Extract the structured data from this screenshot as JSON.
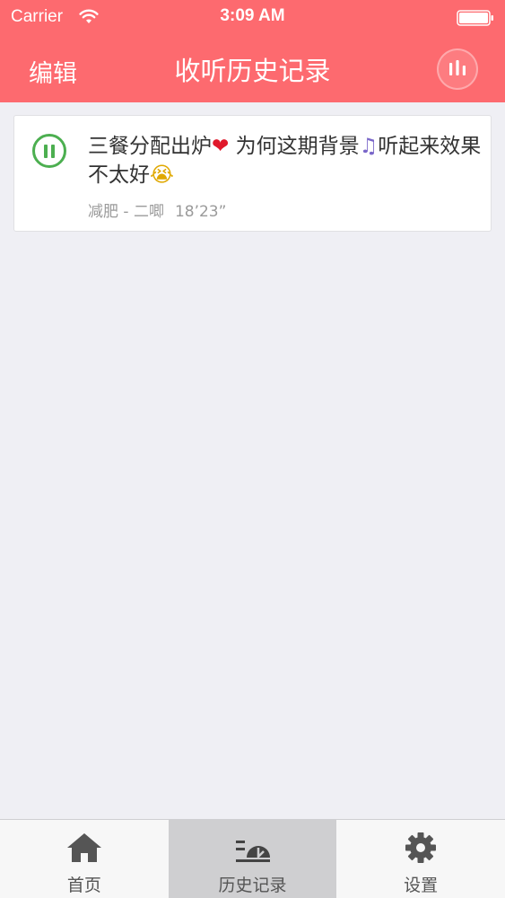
{
  "status_bar": {
    "carrier": "Carrier",
    "time": "3:09 AM"
  },
  "nav": {
    "edit_label": "编辑",
    "title": "收听历史记录"
  },
  "history": [
    {
      "title_part1": "三餐分配出炉",
      "title_part2": " 为何这期背景",
      "title_part3": "听起来效果不太好",
      "emoji_heart": "❤",
      "emoji_note": "♫",
      "emoji_cry": "😭",
      "tag": "减肥 - 二唧",
      "duration": "18’23”",
      "state": "playing"
    }
  ],
  "tabs": [
    {
      "label": "首页",
      "icon": "home-icon",
      "active": false
    },
    {
      "label": "历史记录",
      "icon": "history-icon",
      "active": true
    },
    {
      "label": "设置",
      "icon": "gear-icon",
      "active": false
    }
  ],
  "colors": {
    "accent": "#fd6a6f",
    "play_green": "#4caf50",
    "background": "#efeff4"
  }
}
